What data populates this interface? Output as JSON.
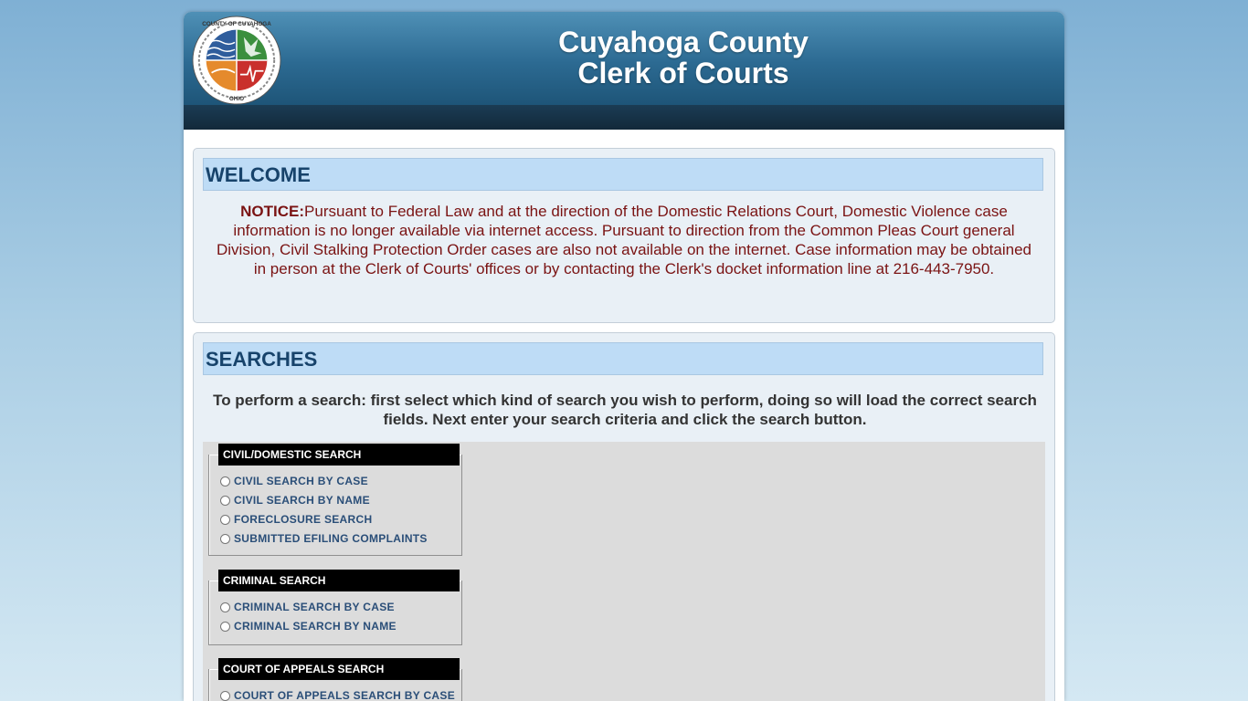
{
  "header": {
    "title_line1": "Cuyahoga County",
    "title_line2": "Clerk of Courts",
    "logo": {
      "icon": "county-seal-icon",
      "top_text": "COUNTY OF CUYAHOGA",
      "bottom_text": "OHIO"
    }
  },
  "welcome": {
    "heading": "WELCOME",
    "notice_label": "NOTICE:",
    "notice_text": "Pursuant to Federal Law and at the direction of the Domestic Relations Court, Domestic Violence case information is no longer available via internet access. Pursuant to direction from the Common Pleas Court general Division, Civil Stalking Protection Order cases are also not available on the internet. Case information may be obtained in person at the Clerk of Courts' offices or by contacting the Clerk's docket information line at 216-443-7950."
  },
  "searches": {
    "heading": "SEARCHES",
    "intro": "To perform a search: first select which kind of search you wish to perform, doing so will load the correct search fields. Next enter your search criteria and click the search button.",
    "groups": [
      {
        "title": "CIVIL/DOMESTIC SEARCH",
        "options": [
          "CIVIL SEARCH BY CASE",
          "CIVIL SEARCH BY NAME",
          "FORECLOSURE SEARCH",
          "SUBMITTED EFILING COMPLAINTS"
        ]
      },
      {
        "title": "CRIMINAL SEARCH",
        "options": [
          "CRIMINAL SEARCH BY CASE",
          "CRIMINAL SEARCH BY NAME"
        ]
      },
      {
        "title": "COURT OF APPEALS SEARCH",
        "options": [
          "COURT OF APPEALS SEARCH BY CASE"
        ]
      }
    ]
  },
  "colors": {
    "header_blue": "#2c6a92",
    "panel_head_bg": "#bedcf6",
    "panel_head_text": "#17436b",
    "notice_text": "#7a1313",
    "option_text": "#2a4e78"
  }
}
